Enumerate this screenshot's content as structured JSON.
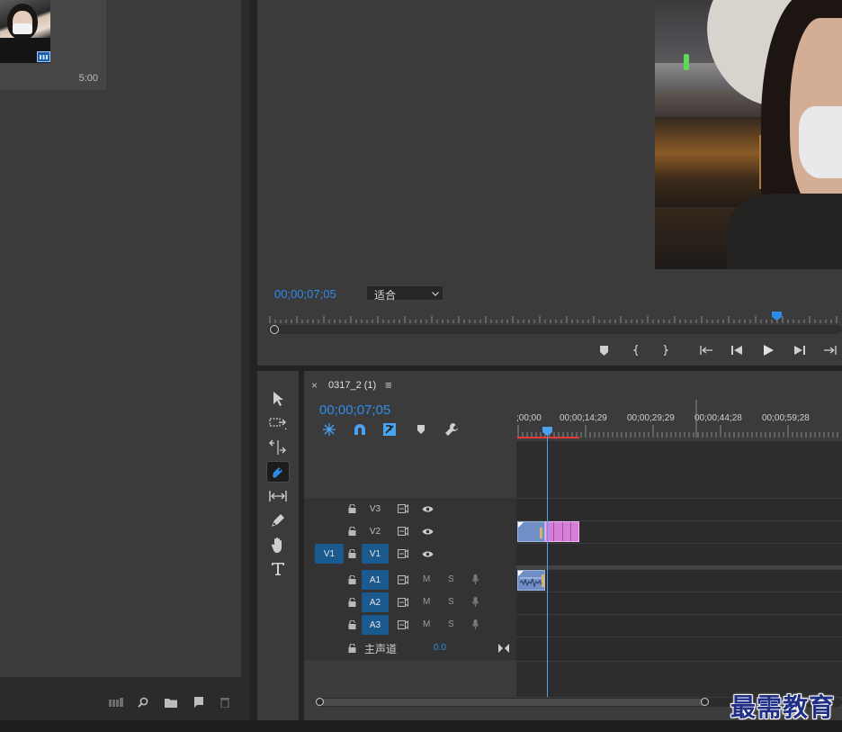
{
  "project": {
    "thumb_duration": "5:00",
    "toolbar_icons": [
      "icon-view-icon",
      "search-icon",
      "folder-icon",
      "new-item-icon",
      "trash-icon"
    ]
  },
  "monitor": {
    "timecode": "00;00;07;05",
    "zoom_select": "适合",
    "transport_icons": [
      "marker-icon",
      "mark-in-icon",
      "mark-out-icon",
      "go-to-in-icon",
      "step-back-icon",
      "play-icon",
      "step-forward-icon",
      "go-to-out-icon"
    ]
  },
  "timeline": {
    "tab_close": "×",
    "tab_name": "0317_2 (1)",
    "tab_menu": "≡",
    "timecode": "00;00;07;05",
    "ruler_labels": [
      ";00;00",
      "00;00;14;29",
      "00;00;29;29",
      "00;00;44;28",
      "00;00;59;28"
    ],
    "video_tracks": [
      {
        "name": "V3",
        "source": ""
      },
      {
        "name": "V2",
        "source": ""
      },
      {
        "name": "V1",
        "source": "V1"
      }
    ],
    "audio_tracks": [
      {
        "name": "A1",
        "m": "M",
        "s": "S"
      },
      {
        "name": "A2",
        "m": "M",
        "s": "S"
      },
      {
        "name": "A3",
        "m": "M",
        "s": "S"
      }
    ],
    "master": {
      "label": "主声道",
      "value": "0.0"
    }
  },
  "tools": [
    "selection-tool-icon",
    "track-select-tool-icon",
    "ripple-edit-tool-icon",
    "razor-tool-icon",
    "slip-tool-icon",
    "pen-tool-icon",
    "hand-tool-icon",
    "type-tool-icon"
  ],
  "watermark": "最需教育",
  "colors": {
    "accent": "#2d8ceb",
    "track_on": "#1b5a8f",
    "clip_blue": "#6f8fc6",
    "clip_pink": "#d57fd6",
    "playhead": "#4aa3f0"
  }
}
